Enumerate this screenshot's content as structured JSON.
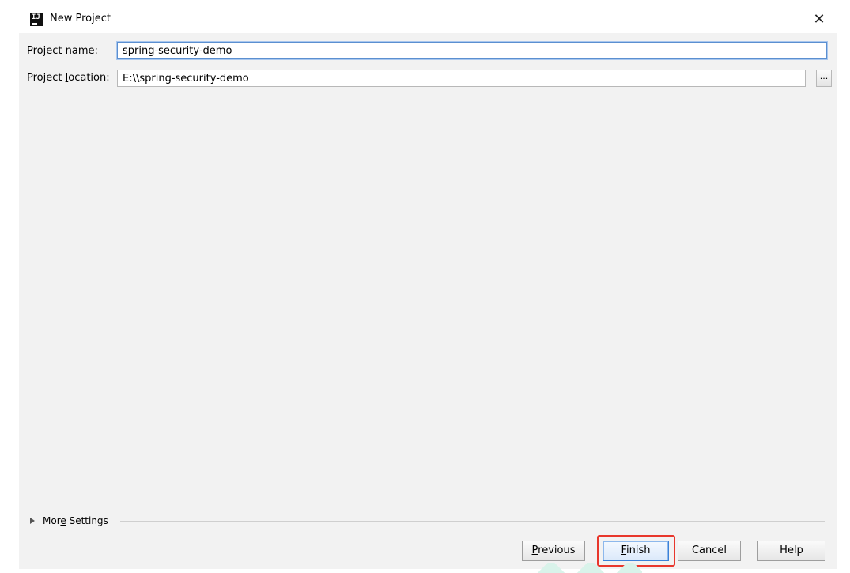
{
  "window": {
    "title": "New Project",
    "app_icon": "intellij-idea-icon",
    "close_icon": "close-icon",
    "close_glyph": "✕"
  },
  "form": {
    "project_name": {
      "label_before": "Project n",
      "label_mnemonic": "a",
      "label_after": "me:",
      "value": "spring-security-demo"
    },
    "project_location": {
      "label_before": "Project ",
      "label_mnemonic": "l",
      "label_after": "ocation:",
      "value": "E:\\\\spring-security-demo",
      "browse_label": "..."
    }
  },
  "more_settings": {
    "label_before": "Mor",
    "label_mnemonic": "e",
    "label_after": " Settings",
    "icon": "expand-triangle-icon"
  },
  "buttons": {
    "previous": {
      "mnemonic": "P",
      "rest": "revious"
    },
    "finish": {
      "mnemonic": "F",
      "rest": "inish"
    },
    "cancel": {
      "label": "Cancel"
    },
    "help": {
      "label": "Help"
    }
  },
  "colors": {
    "dialog_bg": "#f2f2f2",
    "accent": "#3c82d8",
    "highlight": "#e8372c"
  }
}
